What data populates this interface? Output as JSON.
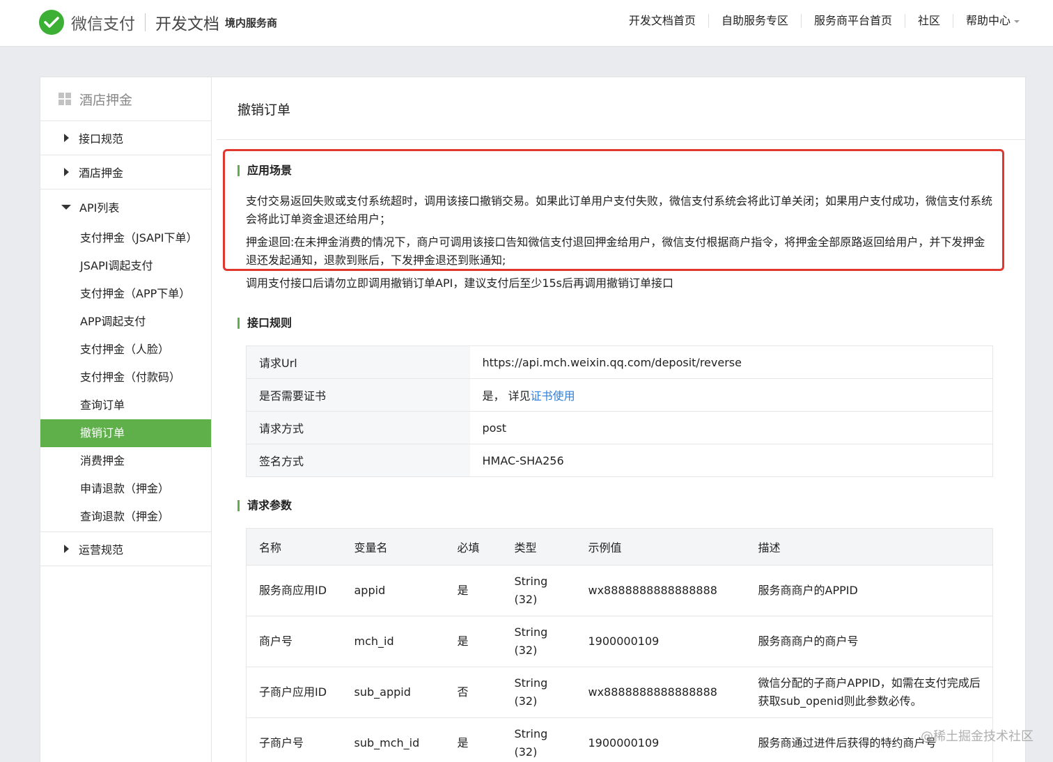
{
  "header": {
    "logo_text": "微信支付",
    "doc_title": "开发文档",
    "doc_sub": "境内服务商",
    "nav": [
      "开发文档首页",
      "自助服务专区",
      "服务商平台首页",
      "社区",
      "帮助中心"
    ]
  },
  "sidebar": {
    "title": "酒店押金",
    "groups": [
      {
        "label": "接口规范"
      },
      {
        "label": "酒店押金"
      },
      {
        "label": "API列表"
      },
      {
        "label": "运营规范"
      }
    ],
    "api_items": [
      "支付押金（JSAPI下单）",
      "JSAPI调起支付",
      "支付押金（APP下单）",
      "APP调起支付",
      "支付押金（人脸）",
      "支付押金（付款码）",
      "查询订单",
      "撤销订单",
      "消费押金",
      "申请退款（押金）",
      "查询退款（押金）"
    ],
    "active_item": "撤销订单"
  },
  "content": {
    "page_title": "撤销订单",
    "scene": {
      "title": "应用场景",
      "p1": "支付交易返回失败或支付系统超时，调用该接口撤销交易。如果此订单用户支付失败，微信支付系统会将此订单关闭；如果用户支付成功，微信支付系统会将此订单资金退还给用户；",
      "p2": "押金退回:在未押金消费的情况下，商户可调用该接口告知微信支付退回押金给用户，微信支付根据商户指令，将押金全部原路返回给用户，并下发押金退还发起通知，退款到账后，下发押金退还到账通知;",
      "p3": "调用支付接口后请勿立即调用撤销订单API，建议支付后至少15s后再调用撤销订单接口"
    },
    "rules": {
      "title": "接口规则",
      "rows": [
        {
          "k": "请求Url",
          "v": "https://api.mch.weixin.qq.com/deposit/reverse"
        },
        {
          "k": "是否需要证书",
          "v": "是， 详见",
          "link": "证书使用"
        },
        {
          "k": "请求方式",
          "v": "post"
        },
        {
          "k": "签名方式",
          "v": "HMAC-SHA256"
        }
      ]
    },
    "params": {
      "title": "请求参数",
      "headers": [
        "名称",
        "变量名",
        "必填",
        "类型",
        "示例值",
        "描述"
      ],
      "rows": [
        [
          "服务商应用ID",
          "appid",
          "是",
          "String(32)",
          "wx8888888888888888",
          "服务商商户的APPID"
        ],
        [
          "商户号",
          "mch_id",
          "是",
          "String(32)",
          "1900000109",
          "服务商商户的商户号"
        ],
        [
          "子商户应用ID",
          "sub_appid",
          "否",
          "String(32)",
          "wx8888888888888888",
          "微信分配的子商户APPID，如需在支付完成后获取sub_openid则此参数必传。"
        ],
        [
          "子商户号",
          "sub_mch_id",
          "是",
          "String(32)",
          "1900000109",
          "服务商通过进件后获得的特约商户号"
        ]
      ]
    }
  },
  "watermark": "@稀土掘金技术社区",
  "colors": {
    "brand_green": "#5fb04b",
    "highlight_red": "#e0372f",
    "link_blue": "#2e7fd9"
  }
}
